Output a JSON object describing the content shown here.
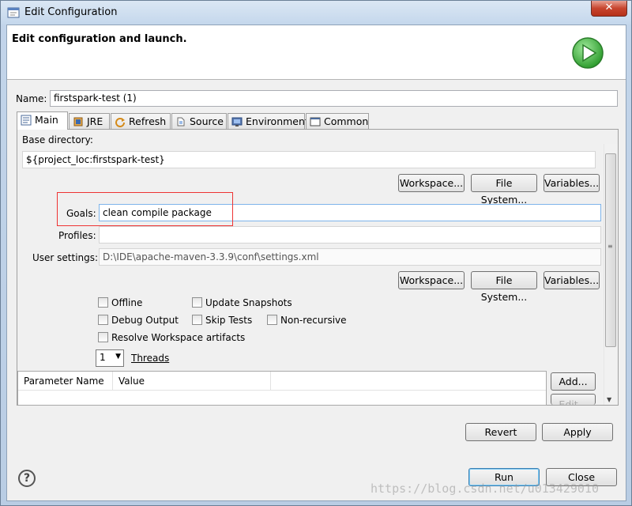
{
  "window": {
    "title": "Edit Configuration",
    "close_glyph": "✕"
  },
  "banner": {
    "title": "Edit configuration and launch."
  },
  "name": {
    "label": "Name:",
    "value": "firstspark-test (1)"
  },
  "tabs": [
    {
      "label": "Main",
      "icon": "main-tab-icon"
    },
    {
      "label": "JRE",
      "icon": "jre-icon"
    },
    {
      "label": "Refresh",
      "icon": "refresh-icon"
    },
    {
      "label": "Source",
      "icon": "source-icon"
    },
    {
      "label": "Environment",
      "icon": "environment-icon"
    },
    {
      "label": "Common",
      "icon": "common-icon"
    }
  ],
  "main": {
    "base_dir_label": "Base directory:",
    "base_dir_value": "${project_loc:firstspark-test}",
    "buttons1": [
      "Workspace...",
      "File System...",
      "Variables..."
    ],
    "goals_label": "Goals:",
    "goals_value": "clean compile package",
    "profiles_label": "Profiles:",
    "profiles_value": "",
    "user_settings_label": "User settings:",
    "user_settings_value": "D:\\IDE\\apache-maven-3.3.9\\conf\\settings.xml",
    "buttons2": [
      "Workspace...",
      "File System...",
      "Variables..."
    ],
    "checkboxes": {
      "offline": "Offline",
      "update_snapshots": "Update Snapshots",
      "debug_output": "Debug Output",
      "skip_tests": "Skip Tests",
      "non_recursive": "Non-recursive",
      "resolve_workspace": "Resolve Workspace artifacts"
    },
    "threads_value": "1",
    "threads_label": "Threads",
    "table_headers": [
      "Parameter Name",
      "Value"
    ],
    "add_button": "Add...",
    "edit_button": "Edit..."
  },
  "footer": {
    "revert": "Revert",
    "apply": "Apply",
    "run": "Run",
    "close": "Close",
    "watermark": "https://blog.csdn.net/u013429010"
  },
  "colors": {
    "highlight": "#e33333",
    "run_green": "#2e9d2e"
  }
}
